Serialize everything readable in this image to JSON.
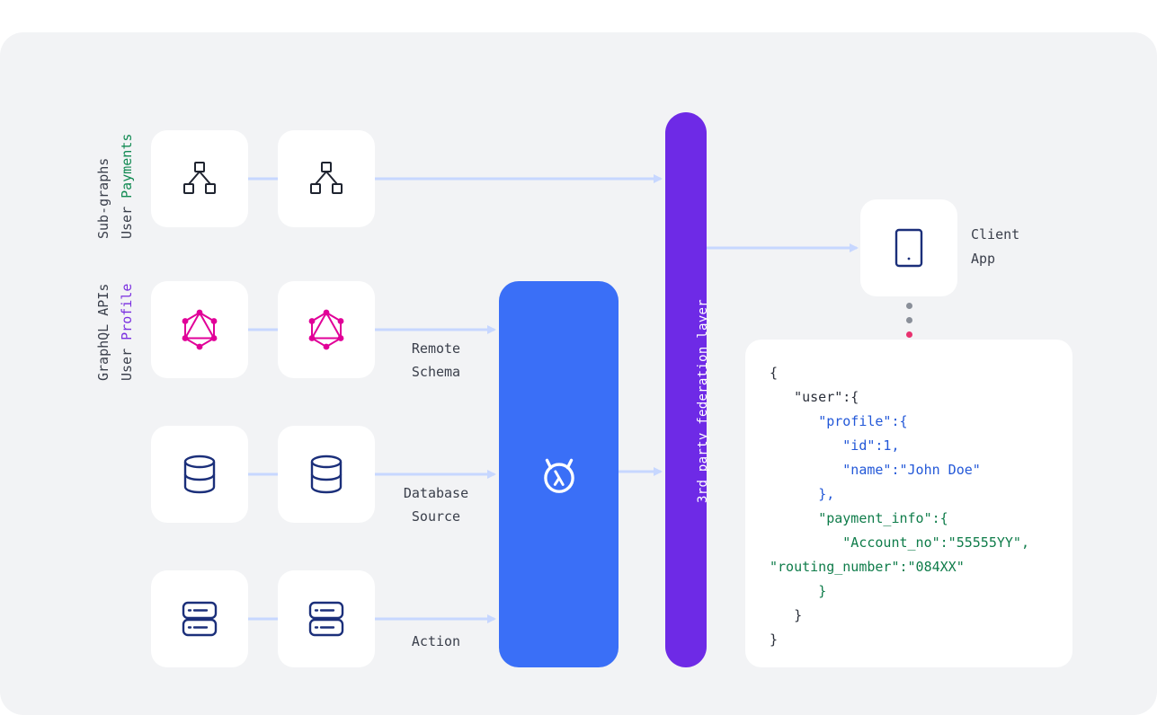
{
  "groups": {
    "subgraphs": {
      "title": "Sub-graphs",
      "prefix": "User",
      "highlight": "Payments"
    },
    "graphql": {
      "title": "GraphQL APIs",
      "prefix": "User",
      "highlight": "Profile"
    }
  },
  "sources": {
    "remote_schema": {
      "line1": "Remote",
      "line2": "Schema"
    },
    "database": {
      "line1": "Database",
      "line2": "Source"
    },
    "action": {
      "line1": "Action"
    }
  },
  "federation_label": "3rd party federation layer",
  "engine_icon": "hasura-lambda-icon",
  "client": {
    "line1": "Client",
    "line2": "App",
    "icon": "tablet-icon"
  },
  "icons": {
    "subgraph": "hierarchy-icon",
    "graphql": "graphql-icon",
    "database": "database-icon",
    "action": "server-icon"
  },
  "colors": {
    "engine": "#3a6ff7",
    "federation": "#6e2ae6",
    "connector": "#c7d7ff",
    "graphql": "#e10098",
    "icon_navy": "#1b2f7a"
  },
  "code": {
    "l1": "{",
    "l2": "\"user\":{",
    "l3": "\"profile\":{",
    "l4": "\"id\":1,",
    "l5": "\"name\":\"John Doe\"",
    "l6": "},",
    "l7": "\"payment_info\":{",
    "l8": "\"Account_no\":\"55555YY\",",
    "l9": "\"routing_number\":\"084XX\"",
    "l10": "}",
    "l11": "}",
    "l12": "}"
  }
}
